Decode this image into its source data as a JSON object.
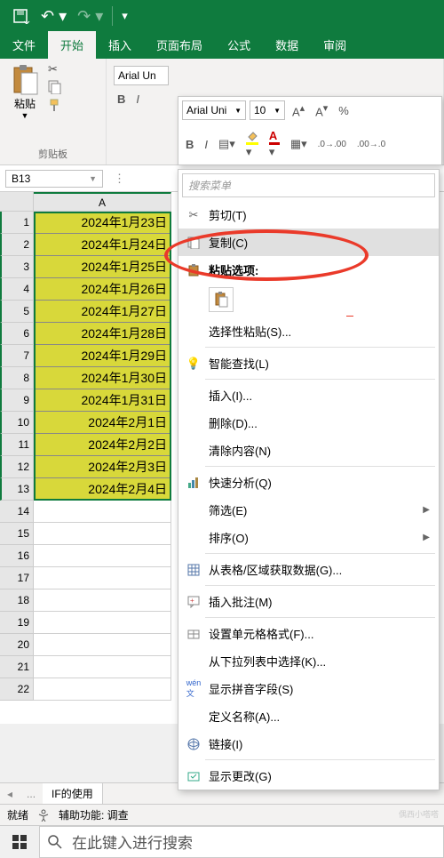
{
  "qat": {
    "save": "💾",
    "undo": "↶",
    "redo": "↷"
  },
  "tabs": {
    "file": "文件",
    "home": "开始",
    "insert": "插入",
    "layout": "页面布局",
    "formulas": "公式",
    "data": "数据",
    "review": "审阅"
  },
  "ribbon": {
    "paste_label": "粘贴",
    "clipboard_label": "剪贴板",
    "font_name_1": "Arial Un",
    "font_name_2": "Arial Uni",
    "font_size": "10",
    "percent": "%"
  },
  "namebox": "B13",
  "col_header": "A",
  "row_numbers": [
    "1",
    "2",
    "3",
    "4",
    "5",
    "6",
    "7",
    "8",
    "9",
    "10",
    "11",
    "12",
    "13",
    "14",
    "15",
    "16",
    "17",
    "18",
    "19",
    "20",
    "21",
    "22"
  ],
  "cells": [
    "2024年1月23日",
    "2024年1月24日",
    "2024年1月25日",
    "2024年1月26日",
    "2024年1月27日",
    "2024年1月28日",
    "2024年1月29日",
    "2024年1月30日",
    "2024年1月31日",
    "2024年2月1日",
    "2024年2月2日",
    "2024年2月3日",
    "2024年2月4日"
  ],
  "sheet": {
    "nav": "...",
    "active": "IF的使用"
  },
  "status": {
    "ready": "就绪",
    "accessibility": "辅助功能: 调查"
  },
  "taskbar": {
    "search_placeholder": "在此键入进行搜索"
  },
  "mini": {
    "font": "Arial Uni",
    "size": "10"
  },
  "ctx": {
    "search": "搜索菜单",
    "cut": "剪切(T)",
    "copy": "复制(C)",
    "paste_header": "粘贴选项:",
    "paste_special": "选择性粘贴(S)...",
    "smart_lookup": "智能查找(L)",
    "insert": "插入(I)...",
    "delete": "删除(D)...",
    "clear": "清除内容(N)",
    "quick_analysis": "快速分析(Q)",
    "filter": "筛选(E)",
    "sort": "排序(O)",
    "get_data": "从表格/区域获取数据(G)...",
    "insert_comment": "插入批注(M)",
    "format_cells": "设置单元格格式(F)...",
    "dropdown": "从下拉列表中选择(K)...",
    "pinyin": "显示拼音字段(S)",
    "define_name": "定义名称(A)...",
    "link": "链接(I)",
    "show_changes": "显示更改(G)"
  },
  "watermark": "偶西小嗒嗒"
}
